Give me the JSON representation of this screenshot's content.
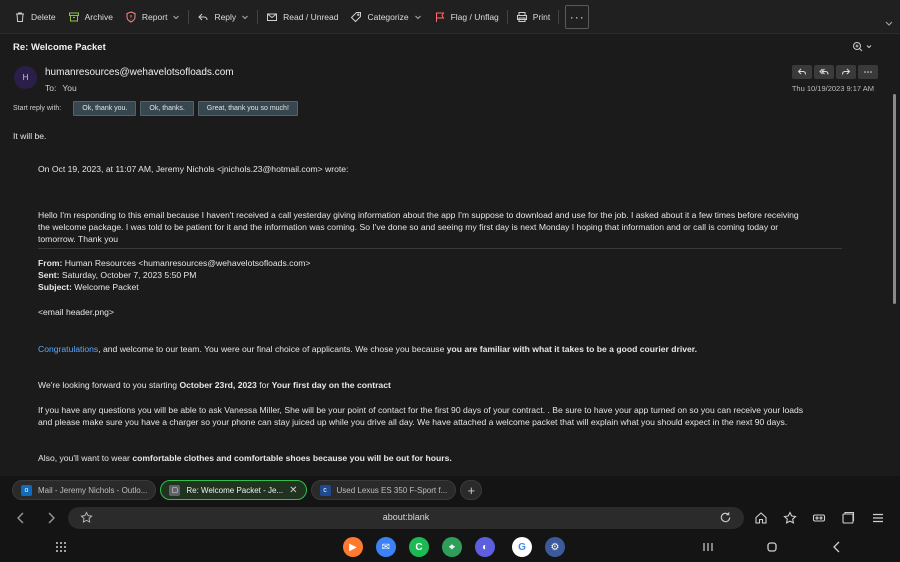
{
  "toolbar": {
    "delete": "Delete",
    "archive": "Archive",
    "report": "Report",
    "reply": "Reply",
    "read_unread": "Read / Unread",
    "categorize": "Categorize",
    "flag": "Flag / Unflag",
    "print": "Print",
    "more": "···"
  },
  "message": {
    "subject": "Re: Welcome Packet",
    "avatar": "H",
    "sender": "humanresources@wehavelotsofloads.com",
    "to_label": "To:",
    "to_value": "You",
    "date": "Thu 10/19/2023 9:17 AM"
  },
  "quick_reply": {
    "label": "Start reply with:",
    "chips": [
      "Ok, thank you.",
      "Ok, thanks.",
      "Great, thank you so much!"
    ]
  },
  "body": {
    "line1": "It will be.",
    "quote_header": "On Oct 19, 2023, at 11:07 AM, Jeremy Nichols <jnichols.23@hotmail.com> wrote:",
    "para1_l1": "Hello I'm responding to this email because I haven't received a call yesterday giving information about the app I'm suppose to download and use for the job. I asked about it a few times before receiving",
    "para1_l2": "the welcome package.  I was told to be patient for it and the information was coming. So I've done so and seeing my first day is next Monday I hoping that information and or call is coming today or",
    "para1_l3": "tomorrow. Thank you",
    "from_label": "From:",
    "from_value": " Human Resources <humanresources@wehavelotsofloads.com>",
    "sent_label": "Sent:",
    "sent_value": " Saturday, October 7, 2023 5:50 PM",
    "subject_label": "Subject:",
    "subject_value": " Welcome Packet",
    "image_placeholder": "<email header.png>",
    "congrats_link": "Congratulations",
    "congrats_rest": ", and welcome to our team. You were our final choice of  applicants. We chose you because ",
    "congrats_bold": "you are familiar with what it takes to be a good courier driver.",
    "looking_pre": "We're looking forward to you starting ",
    "looking_date": "October 23rd, 2023",
    "looking_for": " for ",
    "looking_bold": "Your first day on the contract",
    "questions_l1": "If you have any questions you will be able to ask Vanessa Miller, She will be your point of contact for the first 90 days of your contract. . Be sure to have your app turned on so you can receive your loads",
    "questions_l2": "and please make sure you have a charger so your phone can stay juiced up while you drive all day. We have attached a welcome packet that will explain what you should expect in the next 90 days.",
    "also_pre": "Also, you'll want to wear ",
    "also_bold": "comfortable clothes and comfortable shoes because you will be out for hours."
  },
  "browser": {
    "tabs": [
      {
        "title": "Mail - Jeremy Nichols - Outlo...",
        "favicon": "outlook-icon"
      },
      {
        "title": "Re: Welcome Packet - Je...",
        "favicon": "page-icon"
      },
      {
        "title": "Used Lexus ES 350 F-Sport f...",
        "favicon": "car-site-icon"
      }
    ],
    "url": "about:blank"
  },
  "colors": {
    "accent_link": "#5aa8ff",
    "active_tab_border": "#2fbf4a",
    "chip_bg": "#37474f"
  }
}
